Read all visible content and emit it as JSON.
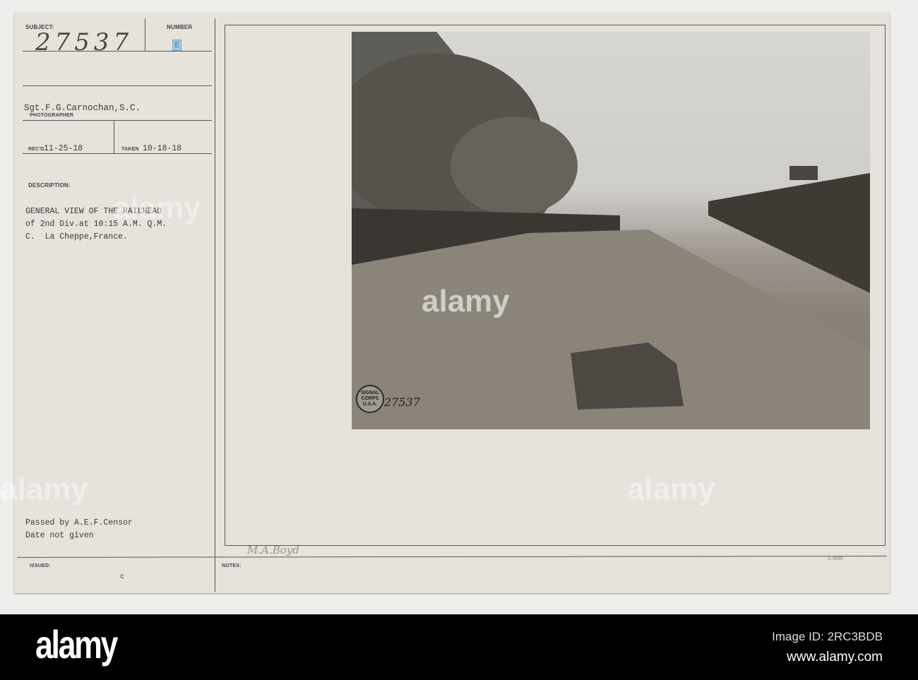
{
  "card": {
    "subject_label": "SUBJECT:",
    "subject_number": "27537",
    "number_label": "NUMBER",
    "number_stamp": "E",
    "photographer": "Sgt.F.G.Carnochan,S.C.",
    "photographer_label": "PHOTOGRAPHER",
    "recd_label": "REC'D",
    "recd_date": "11-25-18",
    "taken_label": "TAKEN",
    "taken_date": "10-18-18",
    "description_label": "DESCRIPTION:",
    "description_lines": [
      "GENERAL VIEW OF THE RAILHEAD",
      "of 2nd Div.at 10:15 A.M. Q.M.",
      "C.  La Cheppe,France."
    ],
    "censor_lines": [
      "Passed by A.E.F.Censor",
      "Date not given"
    ],
    "issued_label": "ISSUED:",
    "issued_value": "c",
    "notes_label": "NOTES:",
    "notes_handwriting": "M.A.Boyd",
    "form_number": "3—5005"
  },
  "photo": {
    "negative_number": "27537",
    "stamp_text": "SIGNAL CORPS U.S.A."
  },
  "watermark": "alamy",
  "footer": {
    "logo": "alamy",
    "image_id": "Image ID: 2RC3BDB",
    "url": "www.alamy.com"
  }
}
